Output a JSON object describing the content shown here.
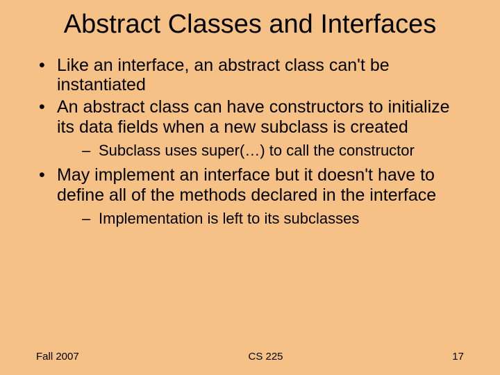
{
  "title": "Abstract Classes and Interfaces",
  "bullets": [
    {
      "text": "Like an interface, an abstract class can't be instantiated",
      "sub": []
    },
    {
      "text": "An abstract class can have constructors to initialize its data fields when a new subclass is created",
      "sub": [
        "Subclass uses super(…) to call the constructor"
      ]
    },
    {
      "text": "May implement an interface but it doesn't have to define all of the methods declared in the interface",
      "sub": [
        "Implementation is left to its subclasses"
      ]
    }
  ],
  "footer": {
    "left": "Fall 2007",
    "center": "CS 225",
    "right": "17"
  }
}
